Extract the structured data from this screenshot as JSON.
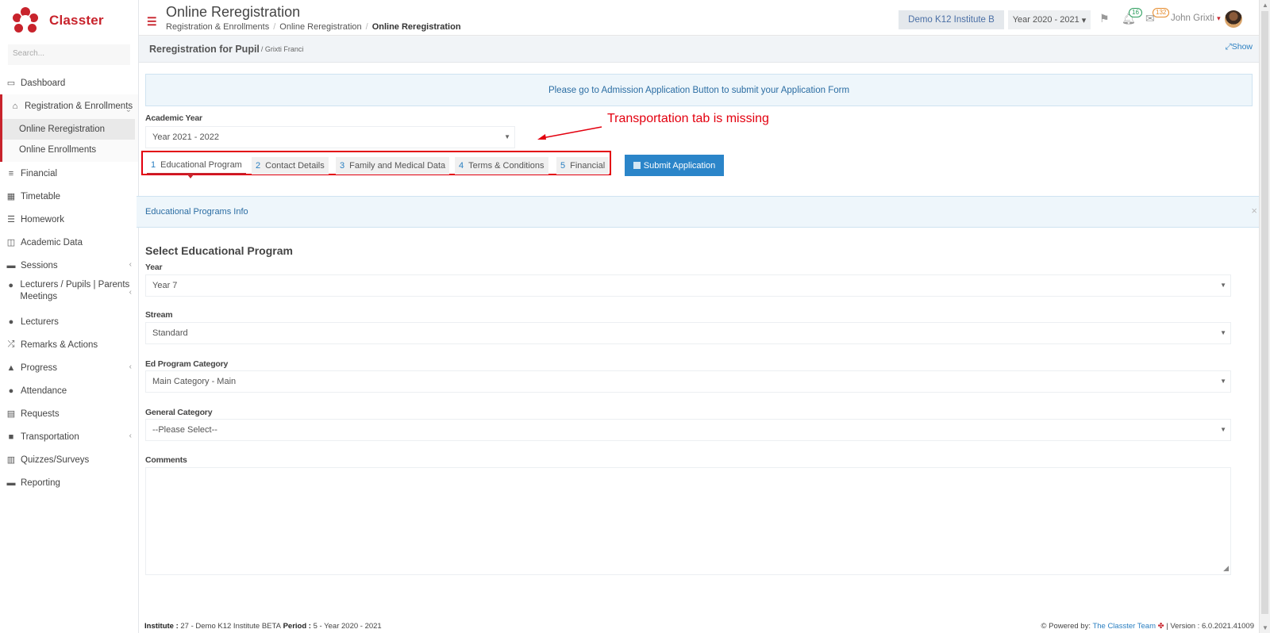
{
  "app": {
    "name": "Classter",
    "search_placeholder": "Search..."
  },
  "sidebar": {
    "items": [
      {
        "label": "Dashboard",
        "icon": "laptop-icon"
      },
      {
        "label": "Registration & Enrollments",
        "icon": "bank-icon"
      },
      {
        "label": "Financial",
        "icon": "coins-icon"
      },
      {
        "label": "Timetable",
        "icon": "calendar-icon"
      },
      {
        "label": "Homework",
        "icon": "list-icon"
      },
      {
        "label": "Academic Data",
        "icon": "user-board-icon"
      },
      {
        "label": "Sessions",
        "icon": "chalkboard-icon"
      },
      {
        "label": "Lecturers / Pupils | Parents Meetings",
        "icon": "users-icon"
      },
      {
        "label": "Lecturers",
        "icon": "users-icon"
      },
      {
        "label": "Remarks & Actions",
        "icon": "shuffle-icon"
      },
      {
        "label": "Progress",
        "icon": "graduation-cap-icon"
      },
      {
        "label": "Attendance",
        "icon": "user-check-icon"
      },
      {
        "label": "Requests",
        "icon": "document-icon"
      },
      {
        "label": "Transportation",
        "icon": "bus-icon"
      },
      {
        "label": "Quizzes/Surveys",
        "icon": "checklist-icon"
      },
      {
        "label": "Reporting",
        "icon": "printer-icon"
      }
    ],
    "subitems": [
      "Online Reregistration",
      "Online Enrollments"
    ]
  },
  "header": {
    "title": "Online Reregistration",
    "breadcrumbs": [
      "Registration & Enrollments",
      "Online Reregistration",
      "Online Reregistration"
    ],
    "institute": "Demo K12 Institute B",
    "year": "Year 2020 - 2021",
    "notifications_count": "16",
    "messages_count": "132",
    "user": "John Grixti"
  },
  "panel": {
    "title": "Reregistration for Pupil",
    "subtitle": "/ Grixti Franci",
    "show": "Show"
  },
  "notice": "Please go to Admission Application Button to submit your Application Form",
  "academic_year": {
    "label": "Academic Year",
    "value": "Year 2021 - 2022"
  },
  "tabs": [
    {
      "num": "1",
      "label": "Educational Program"
    },
    {
      "num": "2",
      "label": "Contact Details"
    },
    {
      "num": "3",
      "label": "Family and Medical Data"
    },
    {
      "num": "4",
      "label": "Terms & Conditions"
    },
    {
      "num": "5",
      "label": "Financial"
    }
  ],
  "submit_label": "Submit Application",
  "annotation": "Transportation tab is missing",
  "info_bar": "Educational Programs Info",
  "form": {
    "section_title": "Select Educational Program",
    "year": {
      "label": "Year",
      "value": "Year 7"
    },
    "stream": {
      "label": "Stream",
      "value": "Standard"
    },
    "ed_category": {
      "label": "Ed Program Category",
      "value": "Main Category - Main"
    },
    "general_category": {
      "label": "General Category",
      "value": "--Please Select--"
    },
    "comments": {
      "label": "Comments"
    }
  },
  "footer": {
    "institute_label": "Institute :",
    "institute_value": "27 - Demo K12 Institute BETA",
    "period_label": "Period :",
    "period_value": "5 - Year 2020 - 2021",
    "powered": "Powered by:",
    "team": "The Classter Team",
    "version": "| Version : 6.0.2021.41009"
  },
  "colors": {
    "brand": "#c8232c",
    "link": "#2a7fc1",
    "primary_button": "#2b85c9",
    "annotation": "#e3000f"
  }
}
